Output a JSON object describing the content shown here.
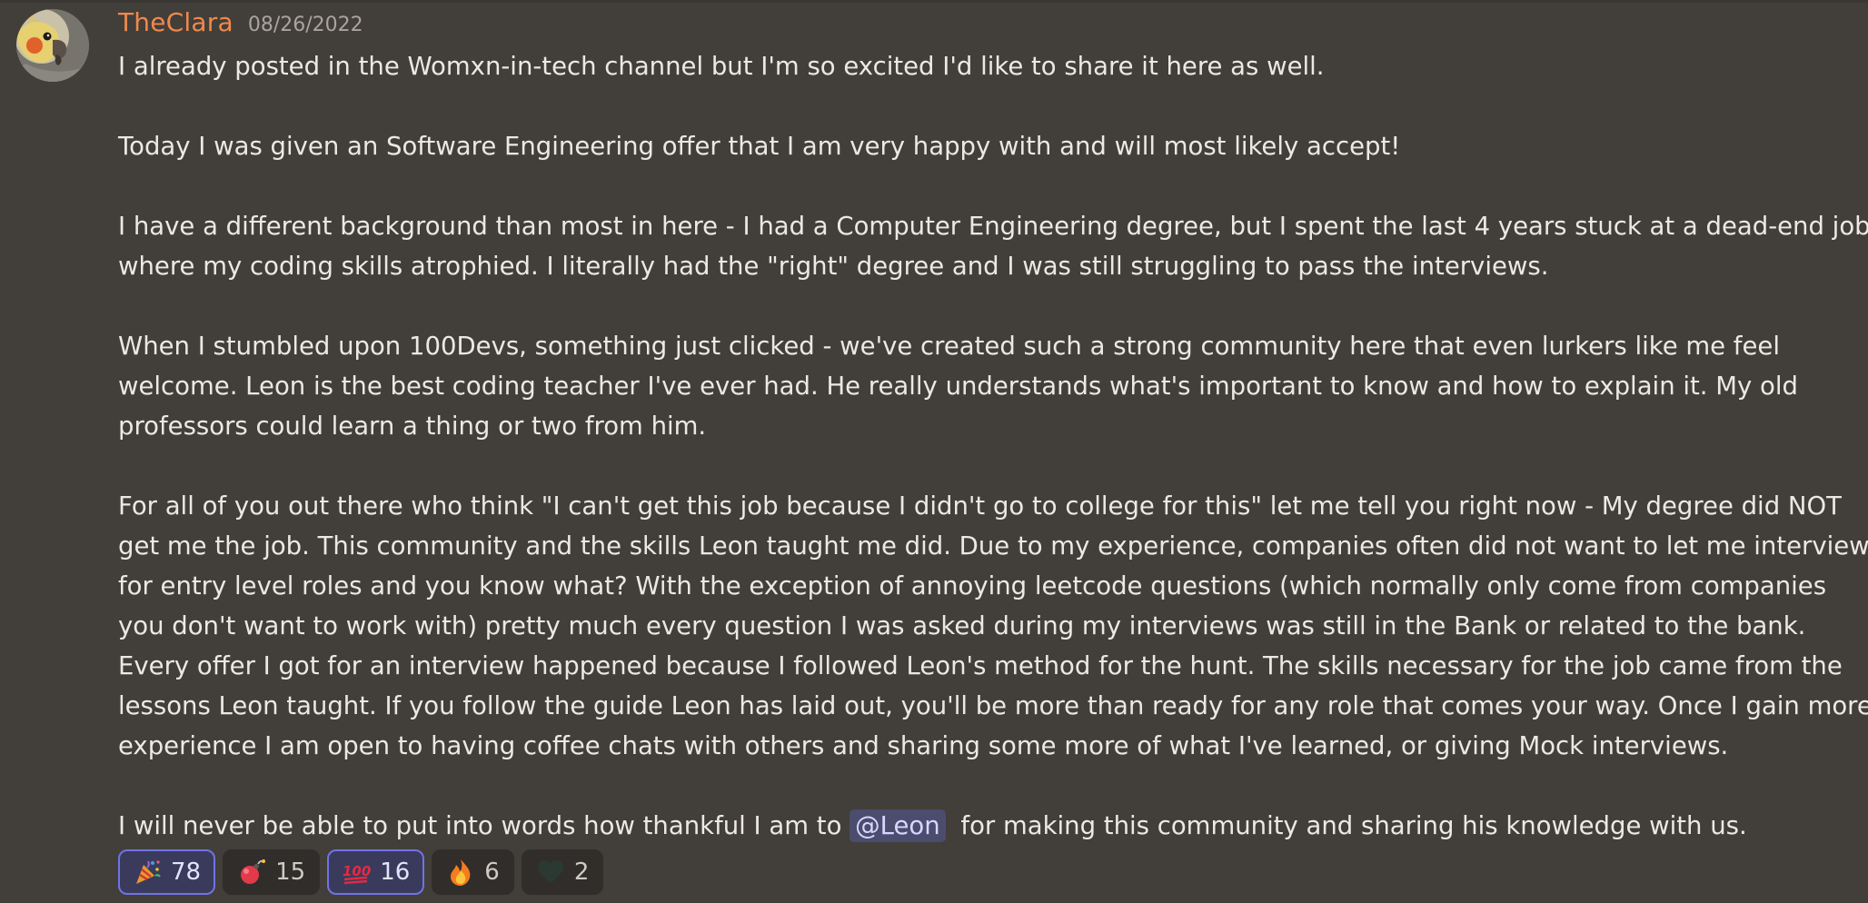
{
  "message": {
    "author": "TheClara",
    "timestamp": "08/26/2022",
    "avatar_icon": "cockatiel-avatar-icon",
    "paragraphs": [
      [
        "I already posted in the Womxn-in-tech channel but I'm so excited I'd like to share it here as well."
      ],
      [
        "Today I was given an Software Engineering offer that I am very happy with and will most likely accept!"
      ],
      [
        "I have a different background than most in here - I had a Computer Engineering degree, but I spent the last 4 years stuck at a dead-end job",
        "where my coding skills atrophied. I literally had the \"right\" degree and I was still struggling to pass the interviews."
      ],
      [
        "When I stumbled upon 100Devs, something just clicked - we've created such a strong community here that even lurkers like me feel",
        "welcome. Leon is the best coding teacher I've ever had. He really understands what's important to know and how to explain it. My old",
        "professors could learn a thing or two from him."
      ],
      [
        "For all of you out there who think \"I can't get this job because I didn't go to college for this\" let me tell you right now - My degree did NOT",
        "get me the job. This community and the skills Leon taught me did. Due to my experience, companies often did not want to let me interview",
        "for entry level roles and you know what? With the exception of annoying leetcode questions (which normally only come from companies",
        "you don't want to work with) pretty much every question I was asked during my interviews was still in the Bank or related to the bank.",
        "Every offer I got for an interview happened because I followed Leon's method for the hunt. The skills necessary for the job came from the",
        "lessons Leon taught. If you follow the guide Leon has laid out, you'll be more than ready for any role that comes your way. Once I gain more",
        "experience I am open to having coffee chats with others and sharing some more of what I've learned, or giving Mock interviews."
      ]
    ],
    "final_line": {
      "before": "I will never be able to put into words how thankful I am to ",
      "mention": "@Leon",
      "after": " for making this community and sharing his knowledge with us."
    }
  },
  "reactions": [
    {
      "emoji": "party-popper-icon",
      "count": "78",
      "reacted": true
    },
    {
      "emoji": "bomb-icon",
      "count": "15",
      "reacted": false
    },
    {
      "emoji": "hundred-points-icon",
      "count": "16",
      "reacted": true
    },
    {
      "emoji": "fire-icon",
      "count": "6",
      "reacted": false
    },
    {
      "emoji": "dark-heart-icon",
      "count": "2",
      "reacted": false
    }
  ],
  "colors": {
    "background": "#423e3a",
    "username": "#f0894a",
    "mention_bg": "#4b4c6e",
    "reacted_border": "#6f73e6"
  }
}
